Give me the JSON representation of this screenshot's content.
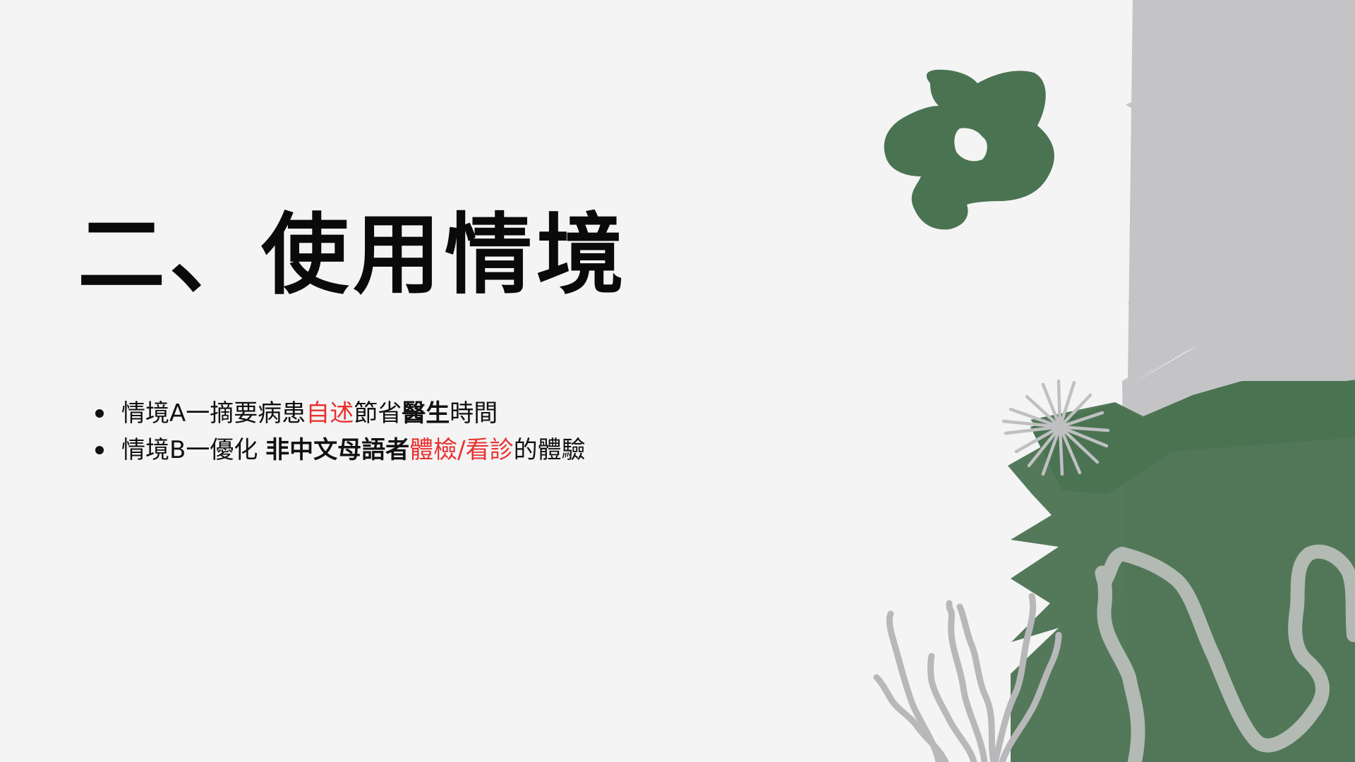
{
  "slide": {
    "title": "二、使用情境",
    "bullets": [
      {
        "segments": [
          {
            "text": "情境A一摘要病患",
            "style": "normal"
          },
          {
            "text": "自述",
            "style": "red"
          },
          {
            "text": "節省",
            "style": "normal"
          },
          {
            "text": "醫生",
            "style": "bold"
          },
          {
            "text": "時間",
            "style": "normal"
          }
        ]
      },
      {
        "segments": [
          {
            "text": "情境B一優化 ",
            "style": "normal"
          },
          {
            "text": "非中文母語者",
            "style": "bold"
          },
          {
            "text": "體檢/看診",
            "style": "red"
          },
          {
            "text": "的體驗",
            "style": "normal"
          }
        ]
      }
    ]
  },
  "colors": {
    "background": "#f4f4f4",
    "title": "#0a0a0a",
    "highlight_red": "#e8312f",
    "leaf_green": "#4a7352",
    "gray_shape": "#c4c4c6"
  },
  "decorations": [
    "flower-shape",
    "gray-zigzag-shape",
    "green-leaf-shape",
    "sunburst-icon",
    "seaweed-shape",
    "wavy-line-shape"
  ]
}
